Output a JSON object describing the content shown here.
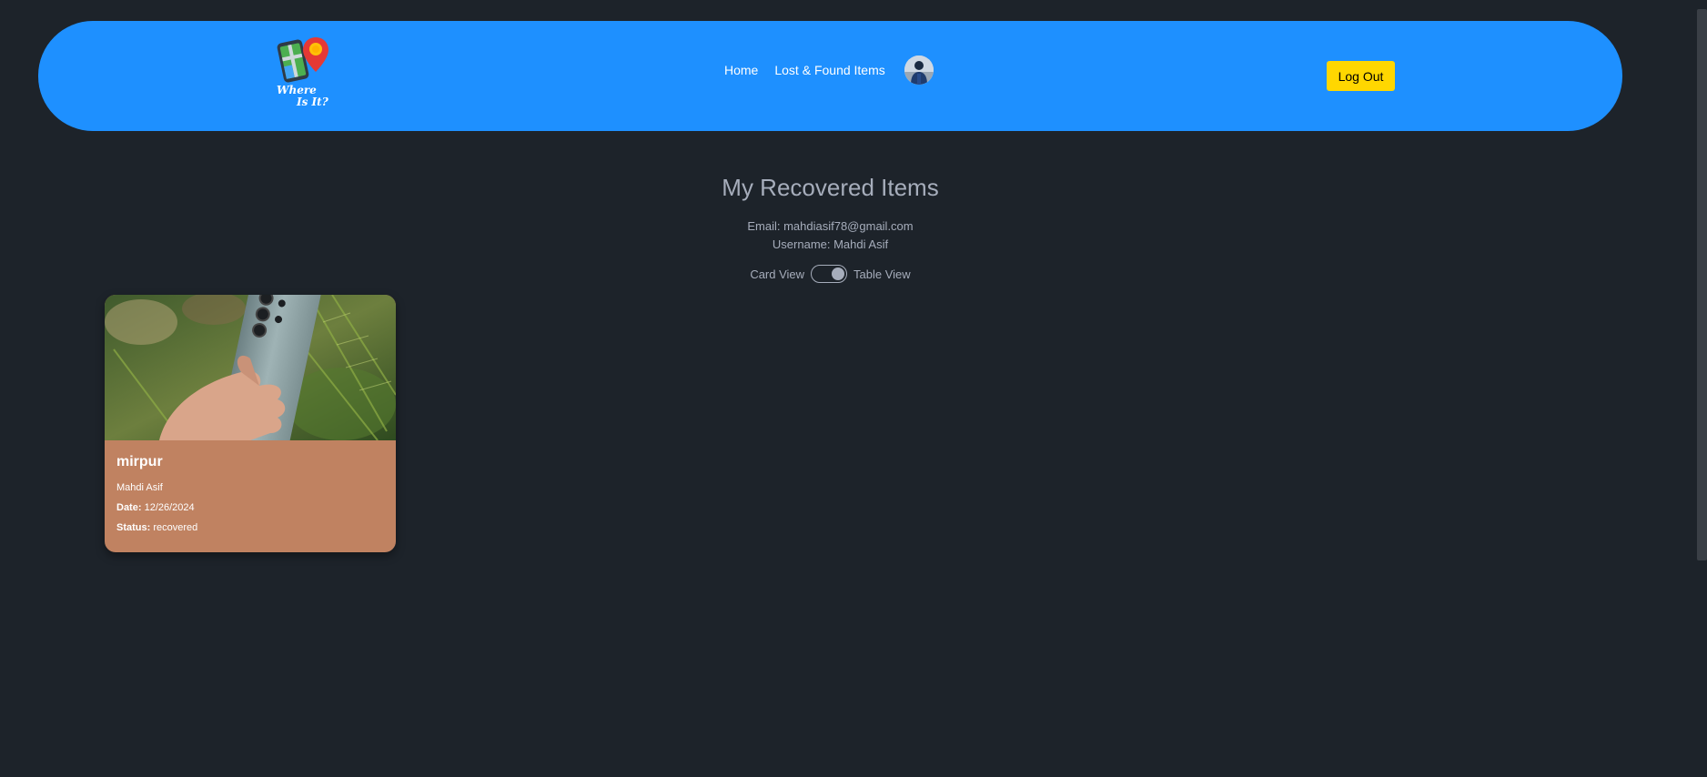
{
  "colors": {
    "background": "#1d232a",
    "navbar": "#1e90ff",
    "logout_button": "#ffd700",
    "card": "#c08261",
    "muted_text": "#a6adbb"
  },
  "navbar": {
    "logo_text_line1": "Where",
    "logo_text_line2": "Is It?",
    "links": [
      {
        "label": "Home"
      },
      {
        "label": "Lost & Found Items"
      }
    ],
    "logout_label": "Log Out"
  },
  "main": {
    "title": "My Recovered Items",
    "email_line": "Email: mahdiasif78@gmail.com",
    "username_line": "Username: Mahdi Asif",
    "toggle": {
      "left_label": "Card View",
      "right_label": "Table View",
      "state": "table"
    },
    "cards": [
      {
        "title": "mirpur",
        "name": "Mahdi Asif",
        "date_label": "Date:",
        "date": "12/26/2024",
        "status_label": "Status:",
        "status": "recovered"
      }
    ]
  }
}
